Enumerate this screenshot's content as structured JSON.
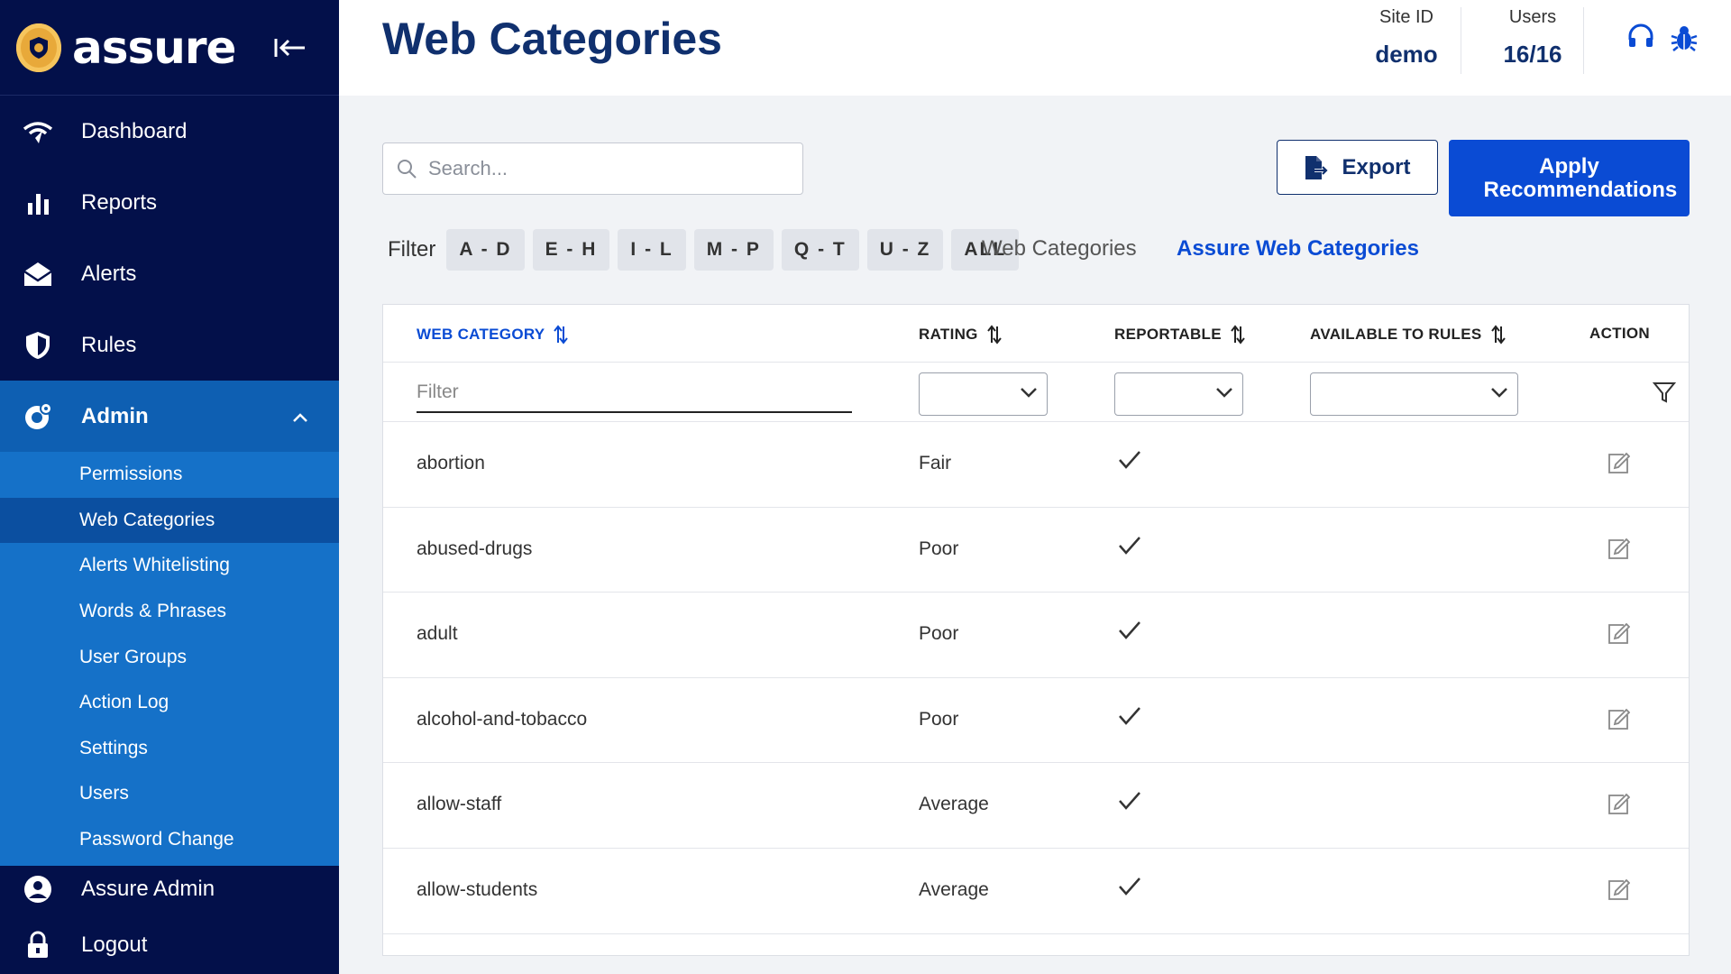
{
  "brand": {
    "name": "assure"
  },
  "sidebar": {
    "items": [
      {
        "label": "Dashboard",
        "icon": "wifi-signal-icon"
      },
      {
        "label": "Reports",
        "icon": "bar-chart-icon"
      },
      {
        "label": "Alerts",
        "icon": "envelope-icon"
      },
      {
        "label": "Rules",
        "icon": "shield-icon"
      }
    ],
    "admin": {
      "label": "Admin",
      "icon": "gear-globe-icon"
    },
    "sub_items": [
      "Permissions",
      "Web Categories",
      "Alerts Whitelisting",
      "Words & Phrases",
      "User Groups",
      "Action Log",
      "Settings",
      "Users",
      "Password Change"
    ],
    "active_sub_item": "Web Categories",
    "bottom": [
      {
        "label": "Assure Admin",
        "icon": "user-circle-icon"
      },
      {
        "label": "Logout",
        "icon": "lock-icon"
      }
    ]
  },
  "header": {
    "title": "Web Categories",
    "site_id_label": "Site ID",
    "site_id_value": "demo",
    "users_label": "Users",
    "users_value": "16/16"
  },
  "toolbar": {
    "search_placeholder": "Search...",
    "export_label": "Export",
    "apply_label": "Apply Recommendations"
  },
  "filters": {
    "label": "Filter",
    "chips": [
      "A - D",
      "E - H",
      "I - L",
      "M - P",
      "Q - T",
      "U - Z",
      "ALL"
    ],
    "tabs": [
      {
        "label": "Web Categories",
        "active": false
      },
      {
        "label": "Assure Web Categories",
        "active": true
      }
    ]
  },
  "table": {
    "columns": {
      "web_category": "WEB CATEGORY",
      "rating": "RATING",
      "reportable": "REPORTABLE",
      "available_to_rules": "AVAILABLE TO RULES",
      "action": "ACTION"
    },
    "filter_placeholder": "Filter",
    "rows": [
      {
        "category": "abortion",
        "rating": "Fair",
        "reportable": true,
        "available_to_rules": false
      },
      {
        "category": "abused-drugs",
        "rating": "Poor",
        "reportable": true,
        "available_to_rules": false
      },
      {
        "category": "adult",
        "rating": "Poor",
        "reportable": true,
        "available_to_rules": false
      },
      {
        "category": "alcohol-and-tobacco",
        "rating": "Poor",
        "reportable": true,
        "available_to_rules": false
      },
      {
        "category": "allow-staff",
        "rating": "Average",
        "reportable": true,
        "available_to_rules": false
      },
      {
        "category": "allow-students",
        "rating": "Average",
        "reportable": true,
        "available_to_rules": false
      }
    ]
  },
  "colors": {
    "sidebar_bg": "#03104a",
    "admin_bg": "#0e5fb2",
    "subnav_bg": "#1571c8",
    "active_sub_bg": "#0b4fa0",
    "primary": "#0a4bd4",
    "title": "#10306e"
  }
}
